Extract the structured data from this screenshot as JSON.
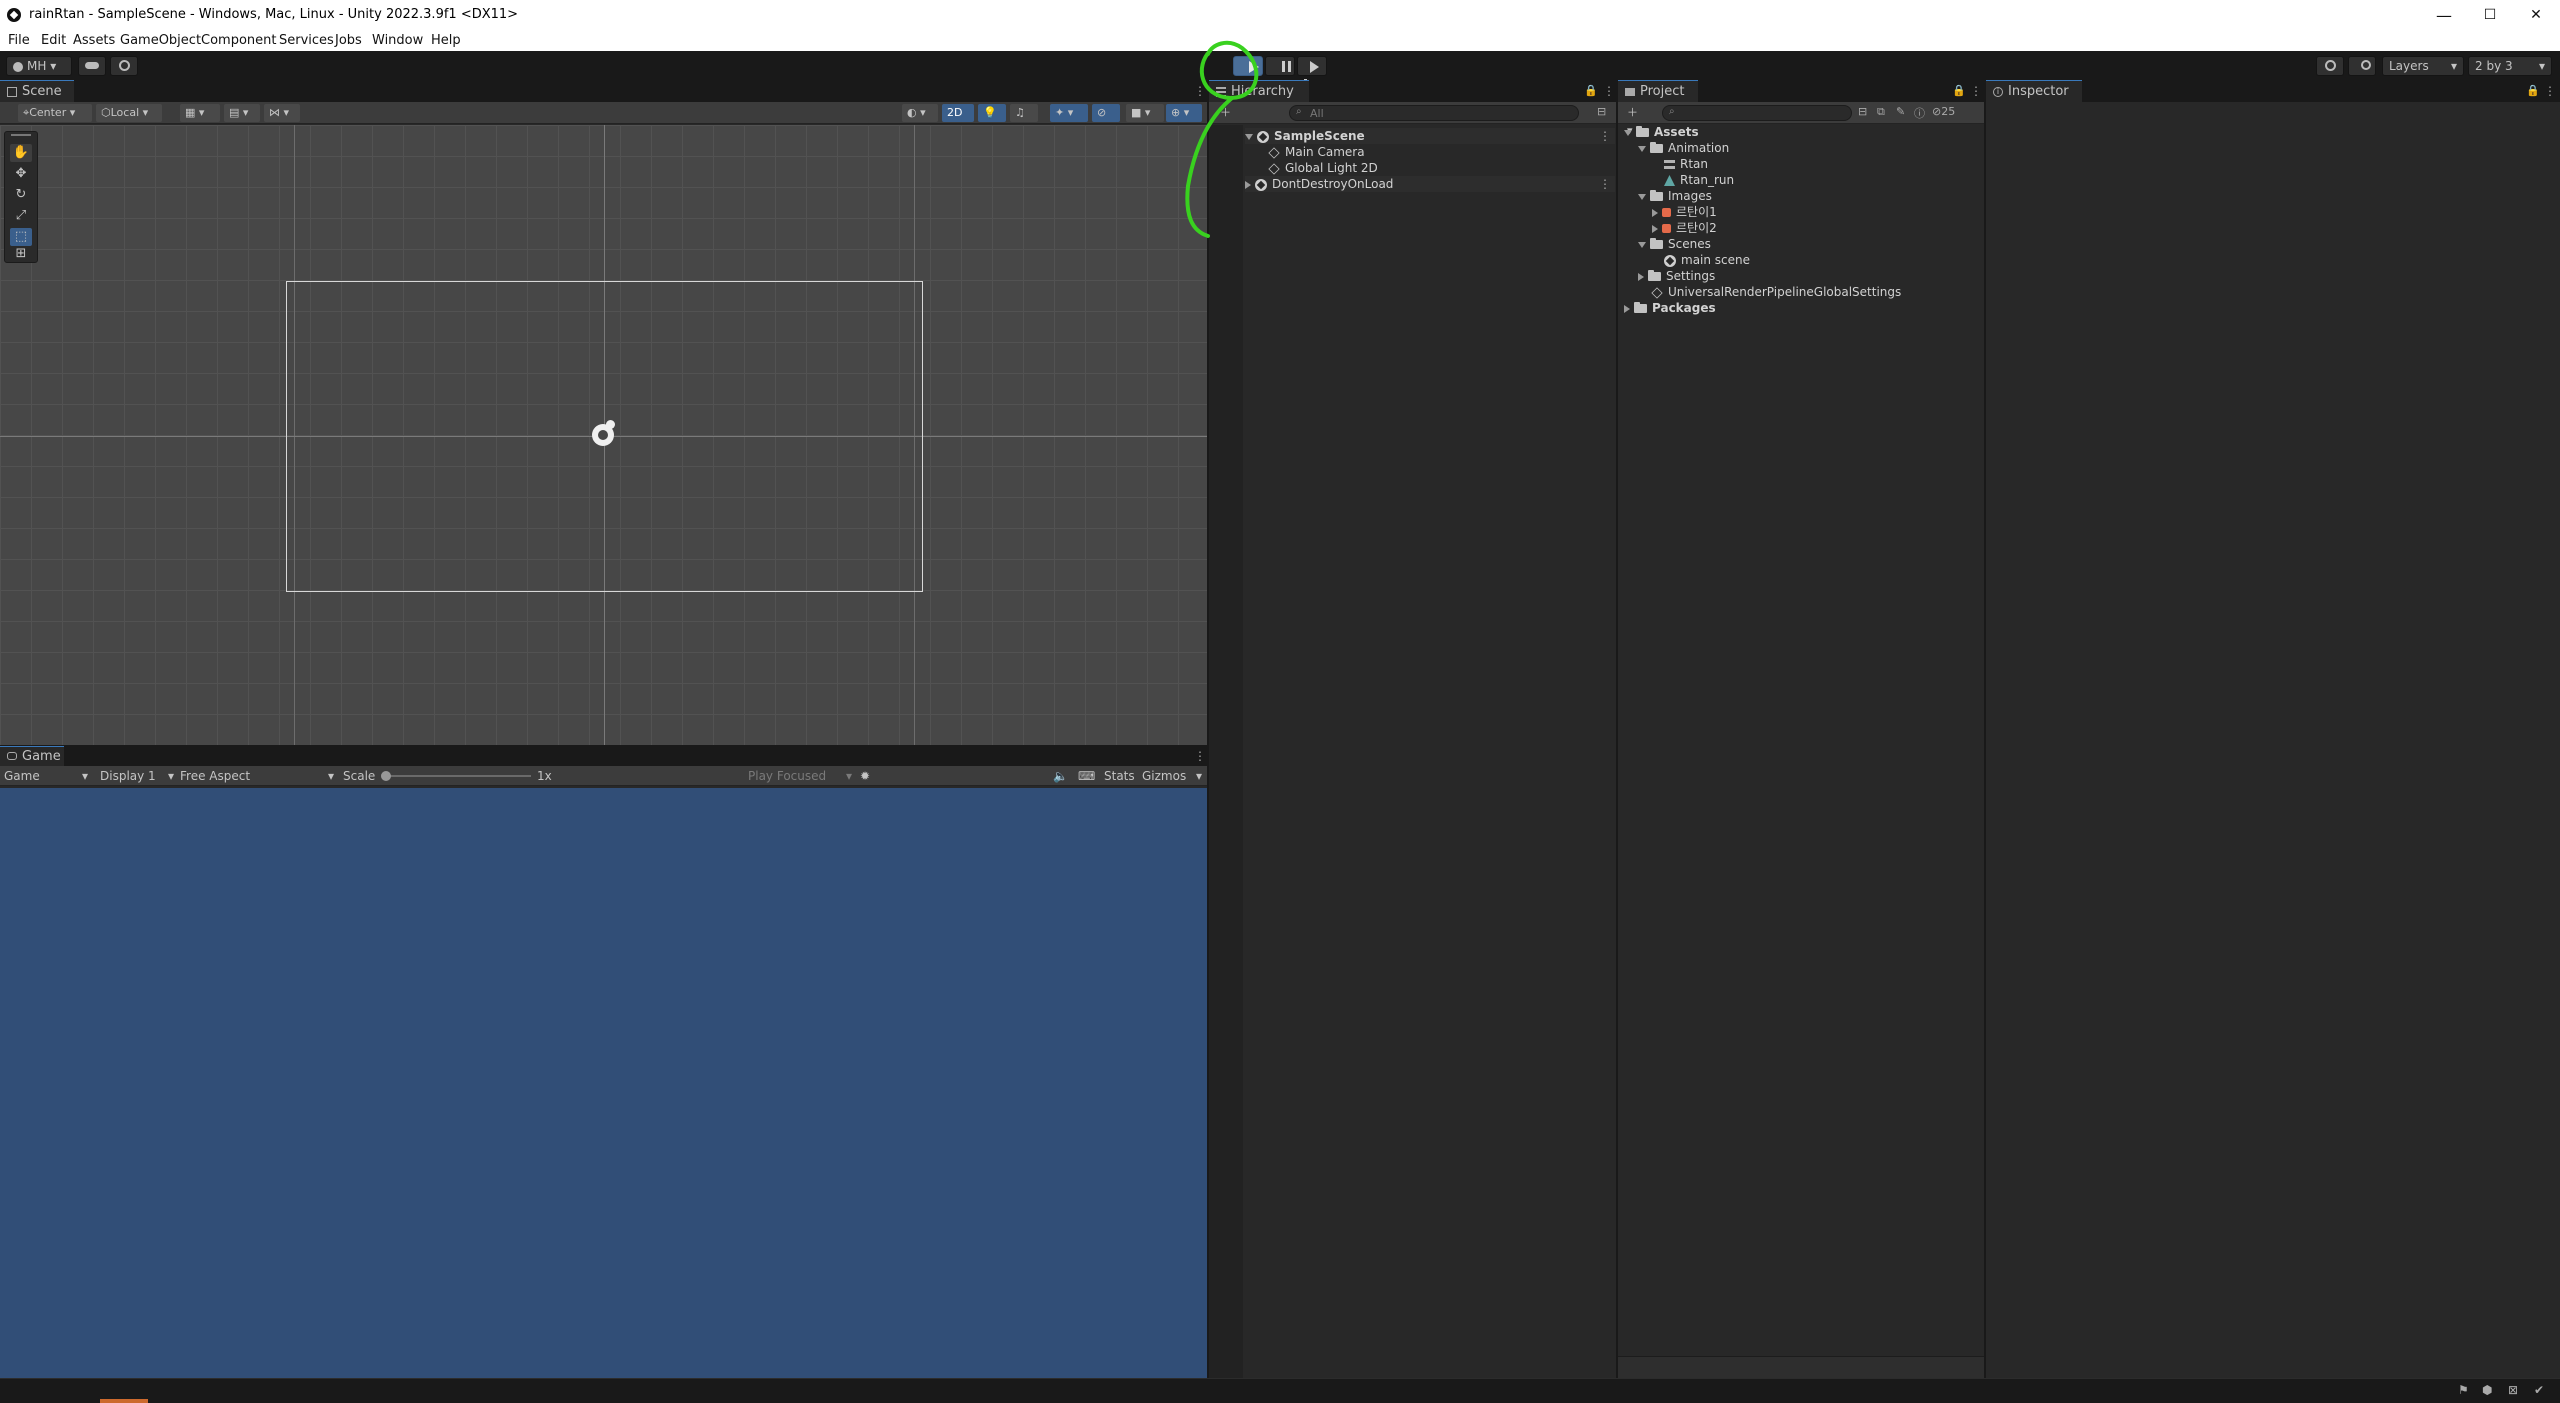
{
  "window": {
    "title": "rainRtan - SampleScene - Windows, Mac, Linux - Unity 2022.3.9f1 <DX11>",
    "minimize": "—",
    "maximize": "☐",
    "close": "✕"
  },
  "menu": [
    "File",
    "Edit",
    "Assets",
    "GameObject",
    "Component",
    "Services",
    "Jobs",
    "Window",
    "Help"
  ],
  "toolbar": {
    "account": "MH",
    "layers": "Layers",
    "layout": "2 by 3",
    "play_icon": "play-icon",
    "pause_icon": "pause-icon",
    "step_icon": "step-icon"
  },
  "scene": {
    "tab": "Scene",
    "pivot": "Center",
    "space": "Local",
    "mode_2d": "2D"
  },
  "game": {
    "tab": "Game",
    "mode": "Game",
    "display": "Display 1",
    "aspect": "Free Aspect",
    "scale_label": "Scale",
    "scale_value": "1x",
    "play_focused": "Play Focused",
    "stats": "Stats",
    "gizmos": "Gizmos",
    "background_color": "#314e77"
  },
  "hierarchy": {
    "tab": "Hierarchy",
    "search_placeholder": "All",
    "items": [
      {
        "label": "SampleScene"
      },
      {
        "label": "Main Camera"
      },
      {
        "label": "Global Light 2D"
      },
      {
        "label": "DontDestroyOnLoad"
      }
    ]
  },
  "project": {
    "tab": "Project",
    "hidden_count": "25",
    "items": [
      {
        "label": "Assets"
      },
      {
        "label": "Animation"
      },
      {
        "label": "Rtan"
      },
      {
        "label": "Rtan_run"
      },
      {
        "label": "Images"
      },
      {
        "label": "르탄이1"
      },
      {
        "label": "르탄이2"
      },
      {
        "label": "Scenes"
      },
      {
        "label": "main scene"
      },
      {
        "label": "Settings"
      },
      {
        "label": "UniversalRenderPipelineGlobalSettings"
      },
      {
        "label": "Packages"
      }
    ]
  },
  "inspector": {
    "tab": "Inspector"
  },
  "annotation_color": "#39d11f"
}
